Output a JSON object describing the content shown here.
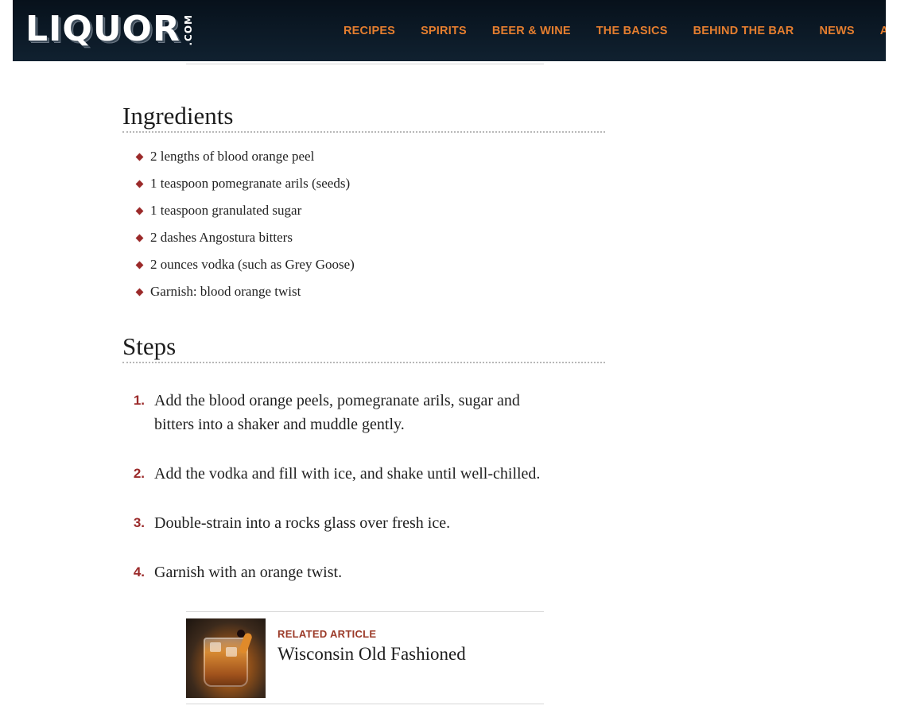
{
  "header": {
    "logo_text": "LIQUOR",
    "logo_suffix": ".COM",
    "nav": [
      {
        "label": "RECIPES"
      },
      {
        "label": "SPIRITS"
      },
      {
        "label": "BEER & WINE"
      },
      {
        "label": "THE BASICS"
      },
      {
        "label": "BEHIND THE BAR"
      },
      {
        "label": "NEWS"
      },
      {
        "label": "A"
      }
    ]
  },
  "ingredients": {
    "heading": "Ingredients",
    "items": [
      "2 lengths of blood orange peel",
      "1 teaspoon pomegranate arils (seeds)",
      "1 teaspoon granulated sugar",
      "2 dashes Angostura bitters",
      "2 ounces vodka (such as Grey Goose)",
      "Garnish: blood orange twist"
    ]
  },
  "steps": {
    "heading": "Steps",
    "items": [
      {
        "num": "1.",
        "text": "Add the blood orange peels, pomegranate arils, sugar and bitters into a shaker and muddle gently."
      },
      {
        "num": "2.",
        "text": "Add the vodka and fill with ice, and shake until well-chilled."
      },
      {
        "num": "3.",
        "text": "Double-strain into a rocks glass over fresh ice."
      },
      {
        "num": "4.",
        "text": "Garnish with an orange twist."
      }
    ]
  },
  "related": {
    "label": "RELATED ARTICLE",
    "title": "Wisconsin Old Fashioned",
    "image": "old-fashioned-cocktail-photo"
  },
  "colors": {
    "header_bg": "#0d1824",
    "nav_text": "#e57e2f",
    "accent": "#9b2a2a"
  }
}
